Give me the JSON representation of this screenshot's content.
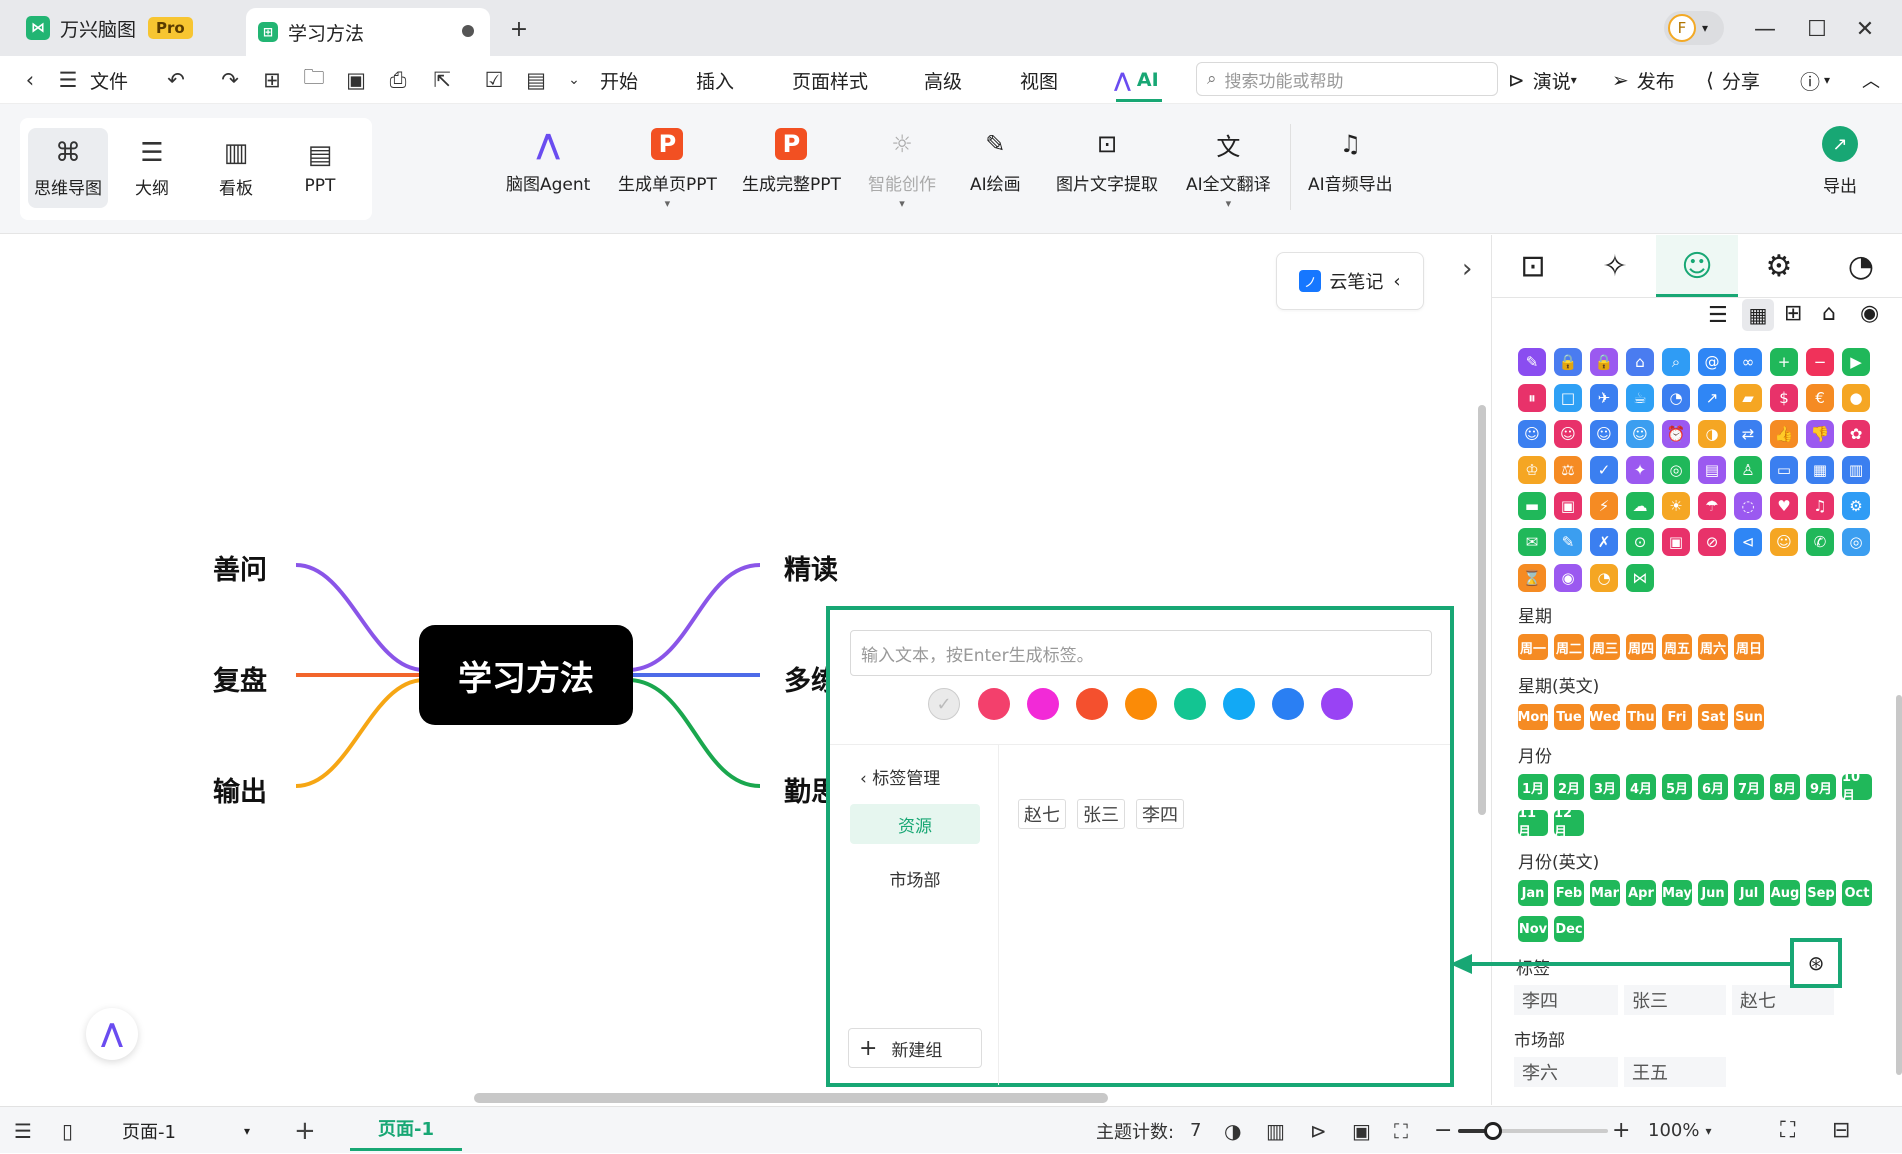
{
  "tabs": [
    {
      "label": "万兴脑图",
      "badge": "Pro"
    },
    {
      "label": "学习方法"
    }
  ],
  "menu": {
    "file": "文件",
    "items": [
      "开始",
      "插入",
      "页面样式",
      "高级",
      "视图"
    ],
    "ai": "AI",
    "search_placeholder": "搜索功能或帮助",
    "present": "演说",
    "publish": "发布",
    "share": "分享"
  },
  "view_modes": [
    "思维导图",
    "大纲",
    "看板",
    "PPT"
  ],
  "ribbon": [
    "脑图Agent",
    "生成单页PPT",
    "生成完整PPT",
    "智能创作",
    "AI绘画",
    "图片文字提取",
    "AI全文翻译",
    "AI音频导出"
  ],
  "export": "导出",
  "cloud_note": "云笔记",
  "mindmap": {
    "central": "学习方法",
    "left": [
      "善问",
      "复盘",
      "输出"
    ],
    "right": [
      "精读",
      "多练",
      "勤思"
    ],
    "right_visible": [
      "精读",
      "多练",
      "勤思"
    ],
    "colors": {
      "left1": "#8a55e8",
      "left2": "#f2652b",
      "left3": "#f6a614",
      "right1": "#8a55e8",
      "right2": "#4d6be8",
      "right3": "#1aa74e"
    }
  },
  "panel": {
    "sections": {
      "week": "星期",
      "week_en": "星期(英文)",
      "month": "月份",
      "month_en": "月份(英文)",
      "tags": "标签",
      "market": "市场部"
    },
    "week": [
      "周一",
      "周二",
      "周三",
      "周四",
      "周五",
      "周六",
      "周日"
    ],
    "week_en": [
      "Mon",
      "Tue",
      "Wed",
      "Thu",
      "Fri",
      "Sat",
      "Sun"
    ],
    "month": [
      "1月",
      "2月",
      "3月",
      "4月",
      "5月",
      "6月",
      "7月",
      "8月",
      "9月",
      "10月",
      "11月",
      "12月"
    ],
    "month_en": [
      "Jan",
      "Feb",
      "Mar",
      "Apr",
      "May",
      "Jun",
      "Jul",
      "Aug",
      "Sep",
      "Oct",
      "Nov",
      "Dec"
    ],
    "tag_items": [
      "李四",
      "张三",
      "赵七"
    ],
    "market_items": [
      "李六",
      "王五"
    ]
  },
  "popup": {
    "input_placeholder": "输入文本，按Enter生成标签。",
    "colors": [
      "#f3406c",
      "#f22ad7",
      "#f4502e",
      "#fb8b07",
      "#13c592",
      "#12a9f5",
      "#2a7ff3",
      "#9943f4"
    ],
    "manage": "标签管理",
    "groups": [
      "资源",
      "市场部"
    ],
    "new_group": "新建组",
    "tags": [
      "赵七",
      "张三",
      "李四"
    ]
  },
  "status": {
    "page_select": "页面-1",
    "page_tab": "页面-1",
    "topic_count_label": "主题计数:",
    "topic_count": "7",
    "zoom": "100%"
  },
  "accent": "#18a774"
}
